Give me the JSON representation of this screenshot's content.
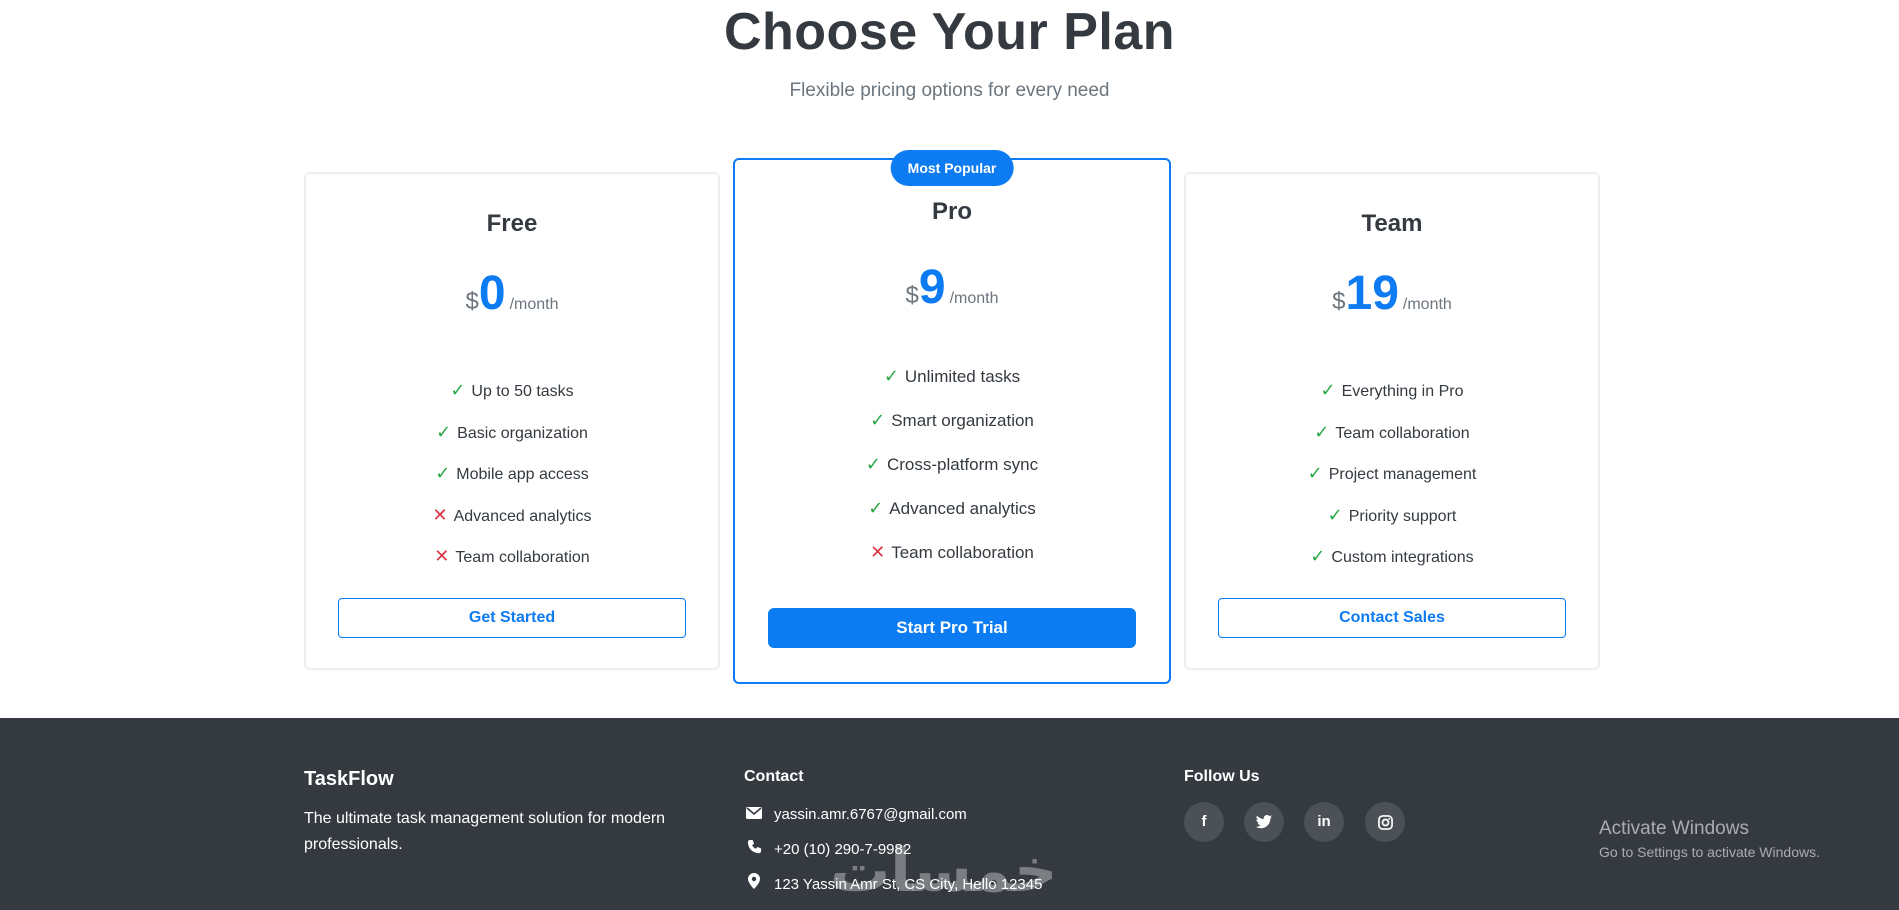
{
  "hero": {
    "title": "Choose Your Plan",
    "subtitle": "Flexible pricing options for every need"
  },
  "plans": [
    {
      "name": "Free",
      "currency": "$",
      "price": "0",
      "period": "/month",
      "features": [
        {
          "text": "Up to 50 tasks",
          "included": true
        },
        {
          "text": "Basic organization",
          "included": true
        },
        {
          "text": "Mobile app access",
          "included": true
        },
        {
          "text": "Advanced analytics",
          "included": false
        },
        {
          "text": "Team collaboration",
          "included": false
        }
      ],
      "button": "Get Started"
    },
    {
      "name": "Pro",
      "badge": "Most Popular",
      "currency": "$",
      "price": "9",
      "period": "/month",
      "features": [
        {
          "text": "Unlimited tasks",
          "included": true
        },
        {
          "text": "Smart organization",
          "included": true
        },
        {
          "text": "Cross-platform sync",
          "included": true
        },
        {
          "text": "Advanced analytics",
          "included": true
        },
        {
          "text": "Team collaboration",
          "included": false
        }
      ],
      "button": "Start Pro Trial"
    },
    {
      "name": "Team",
      "currency": "$",
      "price": "19",
      "period": "/month",
      "features": [
        {
          "text": "Everything in Pro",
          "included": true
        },
        {
          "text": "Team collaboration",
          "included": true
        },
        {
          "text": "Project management",
          "included": true
        },
        {
          "text": "Priority support",
          "included": true
        },
        {
          "text": "Custom integrations",
          "included": true
        }
      ],
      "button": "Contact Sales"
    }
  ],
  "icons": {
    "check": "✓",
    "cross": "✕"
  },
  "footer": {
    "brand": "TaskFlow",
    "description": "The ultimate task management solution for modern professionals.",
    "contact_heading": "Contact",
    "email": "yassin.amr.6767@gmail.com",
    "phone": "+20 (10) 290-7-9982",
    "address": "123 Yassin Amr St, CS City, Hello 12345",
    "follow_heading": "Follow Us",
    "social": [
      "facebook-icon",
      "twitter-icon",
      "linkedin-icon",
      "instagram-icon"
    ]
  },
  "os_overlay": {
    "activate_title": "Activate Windows",
    "activate_sub": "Go to Settings to activate Windows."
  },
  "watermark": "خمسات",
  "colors": {
    "accent": "#0d7bf2",
    "check": "#28a745",
    "cross": "#dc3545",
    "footer_bg": "#343a40"
  }
}
